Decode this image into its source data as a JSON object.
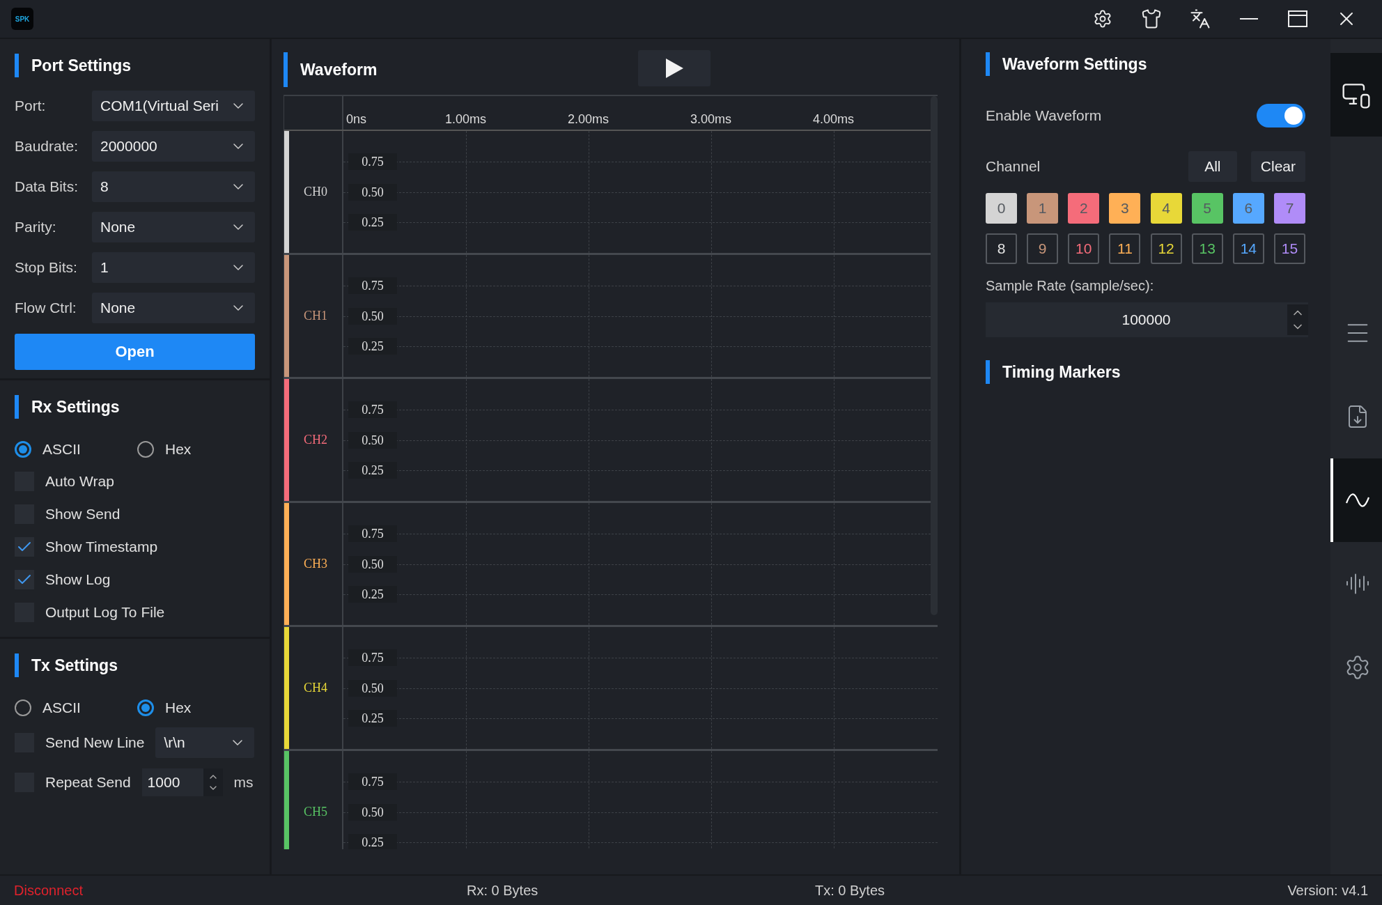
{
  "title_bar": {
    "logo": "SPK"
  },
  "port_settings": {
    "title": "Port Settings",
    "fields": [
      {
        "label": "Port:",
        "value": "COM1(Virtual Seri"
      },
      {
        "label": "Baudrate:",
        "value": "2000000"
      },
      {
        "label": "Data Bits:",
        "value": "8"
      },
      {
        "label": "Parity:",
        "value": "None"
      },
      {
        "label": "Stop Bits:",
        "value": "1"
      },
      {
        "label": "Flow Ctrl:",
        "value": "None"
      }
    ],
    "open_button": "Open"
  },
  "rx_settings": {
    "title": "Rx Settings",
    "modes": [
      {
        "label": "ASCII",
        "selected": true
      },
      {
        "label": "Hex",
        "selected": false
      }
    ],
    "options": [
      {
        "label": "Auto Wrap",
        "checked": false
      },
      {
        "label": "Show Send",
        "checked": false
      },
      {
        "label": "Show Timestamp",
        "checked": true
      },
      {
        "label": "Show Log",
        "checked": true
      },
      {
        "label": "Output Log To File",
        "checked": false
      }
    ]
  },
  "tx_settings": {
    "title": "Tx Settings",
    "modes": [
      {
        "label": "ASCII",
        "selected": false
      },
      {
        "label": "Hex",
        "selected": true
      }
    ],
    "send_new_line": {
      "label": "Send New Line",
      "checked": false,
      "value": "\\r\\n"
    },
    "repeat_send": {
      "label": "Repeat Send",
      "checked": false,
      "value": "1000",
      "unit": "ms"
    }
  },
  "waveform": {
    "title": "Waveform",
    "time_ticks": [
      "0ns",
      "1.00ms",
      "2.00ms",
      "3.00ms",
      "4.00ms"
    ],
    "channels": [
      {
        "name": "CH0",
        "color": "#d4d4d4",
        "ticks": [
          "0.75",
          "0.50",
          "0.25"
        ]
      },
      {
        "name": "CH1",
        "color": "#c8967a",
        "ticks": [
          "0.75",
          "0.50",
          "0.25"
        ]
      },
      {
        "name": "CH2",
        "color": "#f56c7a",
        "ticks": [
          "0.75",
          "0.50",
          "0.25"
        ]
      },
      {
        "name": "CH3",
        "color": "#ffb056",
        "ticks": [
          "0.75",
          "0.50",
          "0.25"
        ]
      },
      {
        "name": "CH4",
        "color": "#e8d838",
        "ticks": [
          "0.75",
          "0.50",
          "0.25"
        ]
      },
      {
        "name": "CH5",
        "color": "#58c464",
        "ticks": [
          "0.75",
          "0.50",
          "0.25"
        ]
      }
    ]
  },
  "waveform_settings": {
    "title": "Waveform Settings",
    "enable": {
      "label": "Enable Waveform",
      "on": true
    },
    "channel_label": "Channel",
    "channel_actions": [
      "All",
      "Clear"
    ],
    "channels": [
      {
        "label": "0",
        "color": "#d4d4d4",
        "selected": true
      },
      {
        "label": "1",
        "color": "#c8967a",
        "selected": true
      },
      {
        "label": "2",
        "color": "#f56c7a",
        "selected": true
      },
      {
        "label": "3",
        "color": "#ffb056",
        "selected": true
      },
      {
        "label": "4",
        "color": "#e8d838",
        "selected": true
      },
      {
        "label": "5",
        "color": "#58c464",
        "selected": true
      },
      {
        "label": "6",
        "color": "#56a8ff",
        "selected": true
      },
      {
        "label": "7",
        "color": "#b08cf8",
        "selected": true
      },
      {
        "label": "8",
        "color": "#e4e4e4",
        "selected": false
      },
      {
        "label": "9",
        "color": "#c8967a",
        "selected": false
      },
      {
        "label": "10",
        "color": "#f56c7a",
        "selected": false
      },
      {
        "label": "11",
        "color": "#ffb056",
        "selected": false
      },
      {
        "label": "12",
        "color": "#e8d838",
        "selected": false
      },
      {
        "label": "13",
        "color": "#58c464",
        "selected": false
      },
      {
        "label": "14",
        "color": "#56a8ff",
        "selected": false
      },
      {
        "label": "15",
        "color": "#b08cf8",
        "selected": false
      }
    ],
    "sample_rate": {
      "label": "Sample Rate (sample/sec):",
      "value": "100000"
    }
  },
  "timing_markers": {
    "title": "Timing Markers"
  },
  "side_bar": {
    "items": [
      {
        "kind": "menu",
        "selected": false
      },
      {
        "kind": "file",
        "selected": false
      },
      {
        "kind": "wave",
        "selected": true
      },
      {
        "kind": "audio",
        "selected": false
      },
      {
        "kind": "settings",
        "selected": false
      }
    ]
  },
  "status_bar": {
    "connection": "Disconnect",
    "rx": "Rx: 0 Bytes",
    "tx": "Tx: 0 Bytes",
    "version": "Version: v4.1"
  }
}
